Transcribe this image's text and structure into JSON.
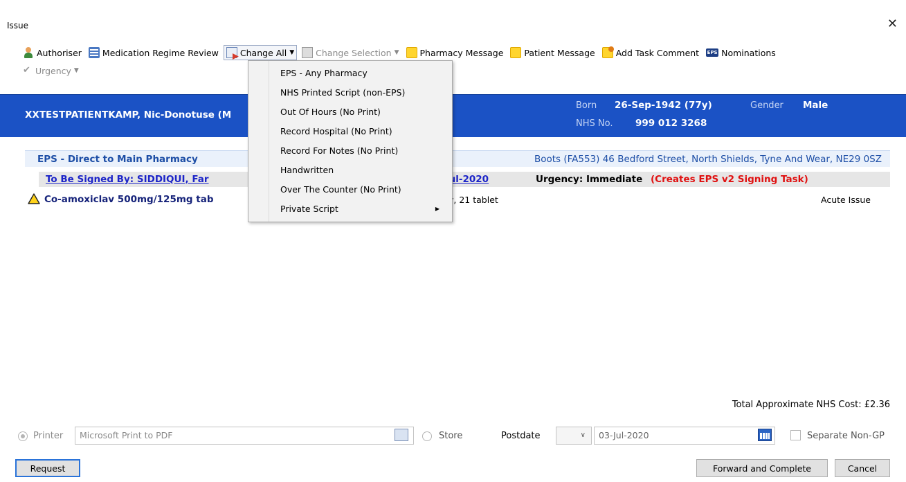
{
  "window": {
    "title": "Issue"
  },
  "toolbar": {
    "authoriser": "Authoriser",
    "medication_regime_review": "Medication Regime Review",
    "change_all": "Change All",
    "change_selection": "Change Selection",
    "pharmacy_message": "Pharmacy Message",
    "patient_message": "Patient Message",
    "add_task_comment": "Add Task Comment",
    "nominations": "Nominations",
    "eps_badge": "EPS",
    "urgency": "Urgency"
  },
  "patient": {
    "name": "XXTESTPATIENTKAMP,  Nic-Donotuse  (M",
    "born_label": "Born",
    "born_value": "26-Sep-1942 (77y)",
    "gender_label": "Gender",
    "gender_value": "Male",
    "nhs_label": "NHS No.",
    "nhs_value": "999 012 3268"
  },
  "change_all_menu": {
    "items": [
      "EPS - Any Pharmacy",
      "NHS Printed Script (non-EPS)",
      "Out Of Hours (No Print)",
      "Record Hospital (No Print)",
      "Record For Notes (No Print)",
      "Handwritten",
      "Over The Counter (No Print)",
      "Private Script"
    ]
  },
  "issue": {
    "pharmacy_title": "EPS - Direct to Main Pharmacy",
    "pharmacy_address": "Boots (FA553)   46 Bedford Street, North Shields, Tyne And Wear, NE29 0SZ",
    "signer": "To Be Signed By: SIDDIQUI, Far",
    "date": "-Jul-2020",
    "urgency": "Urgency: Immediate",
    "creates": "(Creates EPS v2 Signing Task)",
    "medication_name": "Co-amoxiclav 500mg/125mg tab",
    "medication_dose": "y, 21 tablet",
    "medication_type": "Acute Issue",
    "total_cost": "Total Approximate NHS Cost:  £2.36"
  },
  "bottom": {
    "printer_label": "Printer",
    "printer_value": "Microsoft Print to PDF",
    "store_label": "Store",
    "postdate_label": "Postdate",
    "postdate_value": "03-Jul-2020",
    "separate_label": "Separate Non-GP",
    "request": "Request",
    "forward": "Forward and Complete",
    "cancel": "Cancel"
  },
  "colors": {
    "banner": "#1b52c5",
    "accent_red": "#e01010",
    "link_blue": "#1c24c8"
  }
}
